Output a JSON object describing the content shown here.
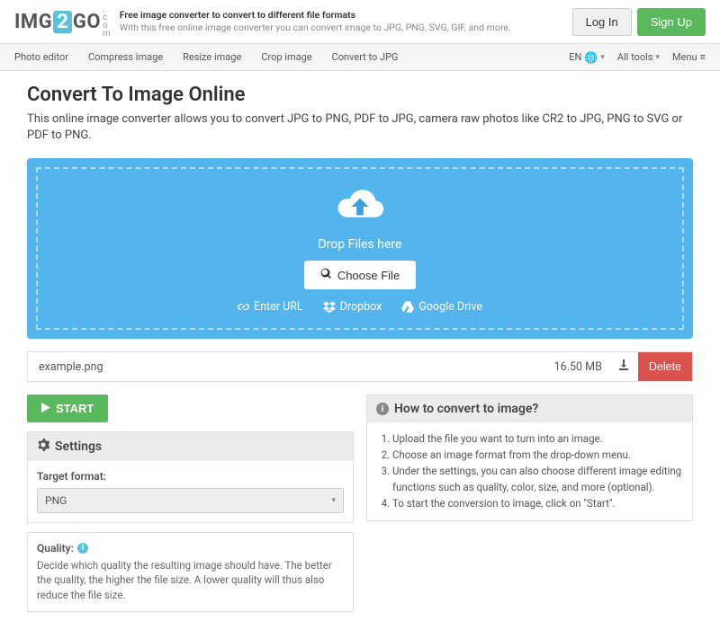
{
  "header": {
    "logo": {
      "pre": "IMG",
      "mid": "2",
      "post": "GO",
      "suffix": ".com"
    },
    "slogan_line1": "Free image converter to convert to different file formats",
    "slogan_line2": "With this free online image converter you can convert image to JPG, PNG, SVG, GIF, and more.",
    "login": "Log In",
    "signup": "Sign Up"
  },
  "subnav": {
    "items": [
      "Photo editor",
      "Compress image",
      "Resize image",
      "Crop image",
      "Convert to JPG"
    ],
    "lang": "EN",
    "all_tools": "All tools",
    "menu": "Menu"
  },
  "page": {
    "title": "Convert To Image Online",
    "desc": "This online image converter allows you to convert JPG to PNG, PDF to JPG, camera raw photos like CR2 to JPG, PNG to SVG or PDF to PNG."
  },
  "dropzone": {
    "title": "Drop Files here",
    "choose": "Choose File",
    "url": "Enter URL",
    "dropbox": "Dropbox",
    "gdrive": "Google Drive"
  },
  "file": {
    "name": "example.png",
    "size": "16.50 MB",
    "delete": "Delete"
  },
  "start": "START",
  "settings": {
    "header": "Settings",
    "target_label": "Target format:",
    "target_value": "PNG",
    "quality_label": "Quality:",
    "quality_desc": "Decide which quality the resulting image should have. The better the quality, the higher the file size. A lower quality will thus also reduce the file size."
  },
  "howto": {
    "header": "How to convert to image?",
    "steps": [
      "Upload the file you want to turn into an image.",
      "Choose an image format from the drop-down menu.",
      "Under the settings, you can also choose different image editing functions such as quality, color, size, and more (optional).",
      "To start the conversion to image, click on \"Start\"."
    ]
  }
}
